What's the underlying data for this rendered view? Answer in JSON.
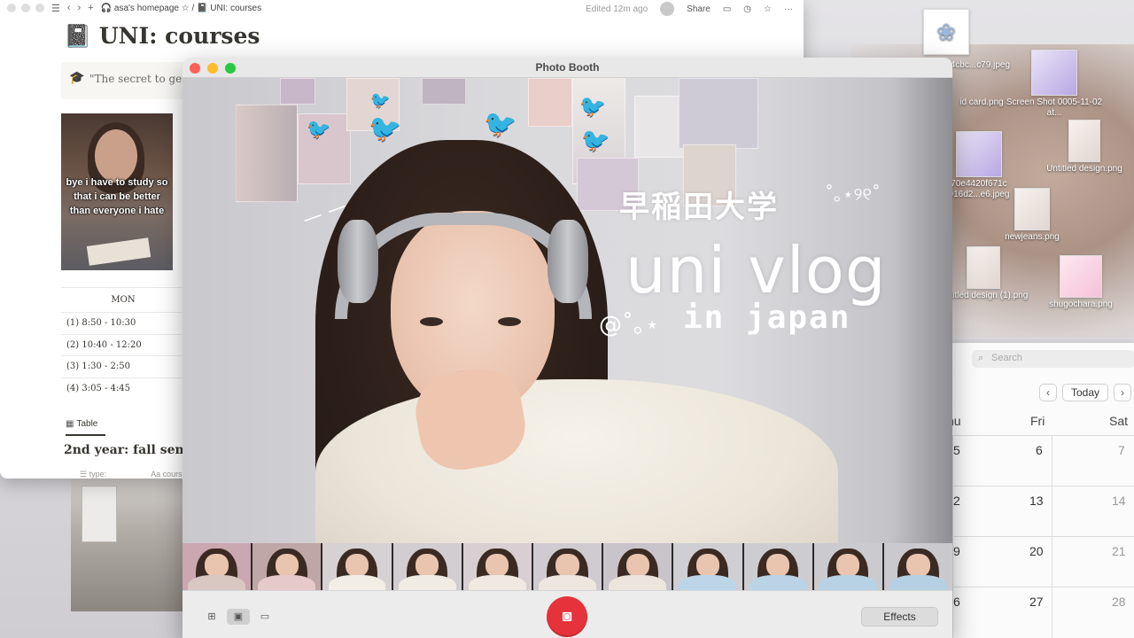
{
  "notion": {
    "breadcrumb_home": "asa's homepage",
    "breadcrumb_page": "UNI: courses",
    "edited": "Edited 12m ago",
    "share": "Share",
    "title": "UNI: courses",
    "title_emoji": "📓",
    "quote_icon": "🎓",
    "quote": "\"The secret to getting",
    "meme_text": "bye i have to study so that i can be better than everyone i hate",
    "schedule": {
      "day": "MON",
      "periods": [
        "(1) 8:50 - 10:30",
        "(2) 10:40 - 12:20",
        "(3) 1:30 - 2:50",
        "(4) 3:05 - 4:45"
      ]
    },
    "tab_label": "Table",
    "section_heading": "2nd year: fall seme",
    "prop_type": "type:",
    "prop_course": "cours"
  },
  "photobooth": {
    "window_title": "Photo Booth",
    "overlay_jp": "早稲田大学",
    "overlay_main": "uni vlog",
    "overlay_sub": "in japan",
    "effects_label": "Effects"
  },
  "desktop_icons": [
    {
      "label": "f4cbc...c79.jpeg"
    },
    {
      "label": "id card.png"
    },
    {
      "label": "Screen Shot 0005-11-02 at..."
    },
    {
      "label": "Untitled design.png"
    },
    {
      "label": "70e4420f671c 916d2...e6.jpeg"
    },
    {
      "label": "newjeans.png"
    },
    {
      "label": "Untitled design (1).png"
    },
    {
      "label": "shugochara.png"
    }
  ],
  "calendar": {
    "search_placeholder": "Search",
    "today": "Today",
    "days": [
      "hu",
      "Fri",
      "Sat"
    ],
    "rows": [
      [
        "5",
        "6",
        "7"
      ],
      [
        "2",
        "13",
        "14"
      ],
      [
        "9",
        "20",
        "21"
      ],
      [
        "6",
        "27",
        "28"
      ]
    ]
  },
  "colors": {
    "close": "#ff5f57",
    "minimize": "#febc2e",
    "zoom": "#28c840",
    "shutter": "#e5323b"
  }
}
